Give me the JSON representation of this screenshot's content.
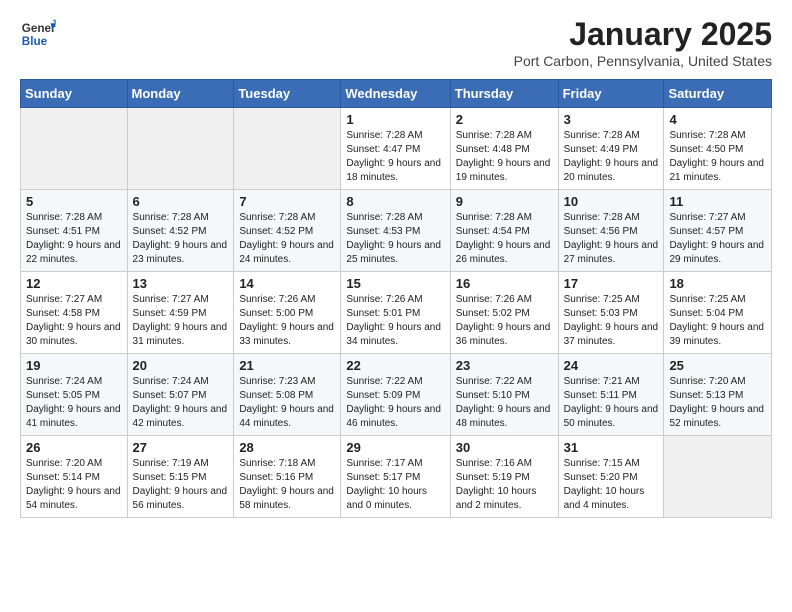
{
  "header": {
    "logo_line1": "General",
    "logo_line2": "Blue",
    "month_year": "January 2025",
    "location": "Port Carbon, Pennsylvania, United States"
  },
  "weekdays": [
    "Sunday",
    "Monday",
    "Tuesday",
    "Wednesday",
    "Thursday",
    "Friday",
    "Saturday"
  ],
  "weeks": [
    [
      {
        "day": "",
        "empty": true
      },
      {
        "day": "",
        "empty": true
      },
      {
        "day": "",
        "empty": true
      },
      {
        "day": "1",
        "sunrise": "7:28 AM",
        "sunset": "4:47 PM",
        "daylight": "9 hours and 18 minutes."
      },
      {
        "day": "2",
        "sunrise": "7:28 AM",
        "sunset": "4:48 PM",
        "daylight": "9 hours and 19 minutes."
      },
      {
        "day": "3",
        "sunrise": "7:28 AM",
        "sunset": "4:49 PM",
        "daylight": "9 hours and 20 minutes."
      },
      {
        "day": "4",
        "sunrise": "7:28 AM",
        "sunset": "4:50 PM",
        "daylight": "9 hours and 21 minutes."
      }
    ],
    [
      {
        "day": "5",
        "sunrise": "7:28 AM",
        "sunset": "4:51 PM",
        "daylight": "9 hours and 22 minutes."
      },
      {
        "day": "6",
        "sunrise": "7:28 AM",
        "sunset": "4:52 PM",
        "daylight": "9 hours and 23 minutes."
      },
      {
        "day": "7",
        "sunrise": "7:28 AM",
        "sunset": "4:52 PM",
        "daylight": "9 hours and 24 minutes."
      },
      {
        "day": "8",
        "sunrise": "7:28 AM",
        "sunset": "4:53 PM",
        "daylight": "9 hours and 25 minutes."
      },
      {
        "day": "9",
        "sunrise": "7:28 AM",
        "sunset": "4:54 PM",
        "daylight": "9 hours and 26 minutes."
      },
      {
        "day": "10",
        "sunrise": "7:28 AM",
        "sunset": "4:56 PM",
        "daylight": "9 hours and 27 minutes."
      },
      {
        "day": "11",
        "sunrise": "7:27 AM",
        "sunset": "4:57 PM",
        "daylight": "9 hours and 29 minutes."
      }
    ],
    [
      {
        "day": "12",
        "sunrise": "7:27 AM",
        "sunset": "4:58 PM",
        "daylight": "9 hours and 30 minutes."
      },
      {
        "day": "13",
        "sunrise": "7:27 AM",
        "sunset": "4:59 PM",
        "daylight": "9 hours and 31 minutes."
      },
      {
        "day": "14",
        "sunrise": "7:26 AM",
        "sunset": "5:00 PM",
        "daylight": "9 hours and 33 minutes."
      },
      {
        "day": "15",
        "sunrise": "7:26 AM",
        "sunset": "5:01 PM",
        "daylight": "9 hours and 34 minutes."
      },
      {
        "day": "16",
        "sunrise": "7:26 AM",
        "sunset": "5:02 PM",
        "daylight": "9 hours and 36 minutes."
      },
      {
        "day": "17",
        "sunrise": "7:25 AM",
        "sunset": "5:03 PM",
        "daylight": "9 hours and 37 minutes."
      },
      {
        "day": "18",
        "sunrise": "7:25 AM",
        "sunset": "5:04 PM",
        "daylight": "9 hours and 39 minutes."
      }
    ],
    [
      {
        "day": "19",
        "sunrise": "7:24 AM",
        "sunset": "5:05 PM",
        "daylight": "9 hours and 41 minutes."
      },
      {
        "day": "20",
        "sunrise": "7:24 AM",
        "sunset": "5:07 PM",
        "daylight": "9 hours and 42 minutes."
      },
      {
        "day": "21",
        "sunrise": "7:23 AM",
        "sunset": "5:08 PM",
        "daylight": "9 hours and 44 minutes."
      },
      {
        "day": "22",
        "sunrise": "7:22 AM",
        "sunset": "5:09 PM",
        "daylight": "9 hours and 46 minutes."
      },
      {
        "day": "23",
        "sunrise": "7:22 AM",
        "sunset": "5:10 PM",
        "daylight": "9 hours and 48 minutes."
      },
      {
        "day": "24",
        "sunrise": "7:21 AM",
        "sunset": "5:11 PM",
        "daylight": "9 hours and 50 minutes."
      },
      {
        "day": "25",
        "sunrise": "7:20 AM",
        "sunset": "5:13 PM",
        "daylight": "9 hours and 52 minutes."
      }
    ],
    [
      {
        "day": "26",
        "sunrise": "7:20 AM",
        "sunset": "5:14 PM",
        "daylight": "9 hours and 54 minutes."
      },
      {
        "day": "27",
        "sunrise": "7:19 AM",
        "sunset": "5:15 PM",
        "daylight": "9 hours and 56 minutes."
      },
      {
        "day": "28",
        "sunrise": "7:18 AM",
        "sunset": "5:16 PM",
        "daylight": "9 hours and 58 minutes."
      },
      {
        "day": "29",
        "sunrise": "7:17 AM",
        "sunset": "5:17 PM",
        "daylight": "10 hours and 0 minutes."
      },
      {
        "day": "30",
        "sunrise": "7:16 AM",
        "sunset": "5:19 PM",
        "daylight": "10 hours and 2 minutes."
      },
      {
        "day": "31",
        "sunrise": "7:15 AM",
        "sunset": "5:20 PM",
        "daylight": "10 hours and 4 minutes."
      },
      {
        "day": "",
        "empty": true
      }
    ]
  ],
  "labels": {
    "sunrise": "Sunrise:",
    "sunset": "Sunset:",
    "daylight": "Daylight:"
  }
}
